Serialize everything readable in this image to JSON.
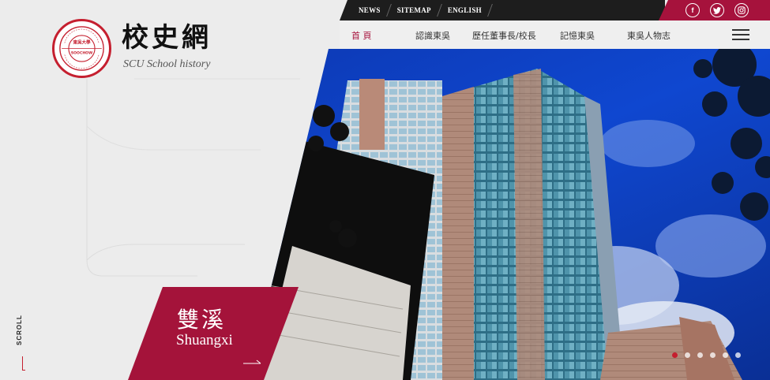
{
  "logo": {
    "title": "校史網",
    "subtitle": "SCU School history",
    "seal_text": "SOOCHOW UNIVERSITY",
    "seal_motto": "UNTO A FULL GROWN MAN",
    "seal_cn": "東吳大學"
  },
  "topbar": {
    "links": [
      "NEWS",
      "SITEMAP",
      "ENGLISH"
    ],
    "socials": [
      {
        "icon": "facebook-icon",
        "glyph": "f"
      },
      {
        "icon": "twitter-icon",
        "glyph": "t"
      },
      {
        "icon": "instagram-icon",
        "glyph": "◎"
      }
    ]
  },
  "nav": {
    "items": [
      "首 頁",
      "認識東吳",
      "歷任董事長/校長",
      "記憶東吳",
      "東吳人物志"
    ],
    "active": 0
  },
  "hero": {
    "caption_zh": "雙溪",
    "caption_en": "Shuangxi",
    "slides": 6,
    "active_slide": 0
  },
  "scroll_label": "SCROLL",
  "colors": {
    "brand_red": "#a6123c",
    "topbar_dark": "#1d1d1d",
    "sky_blue": "#0a3bbd"
  }
}
